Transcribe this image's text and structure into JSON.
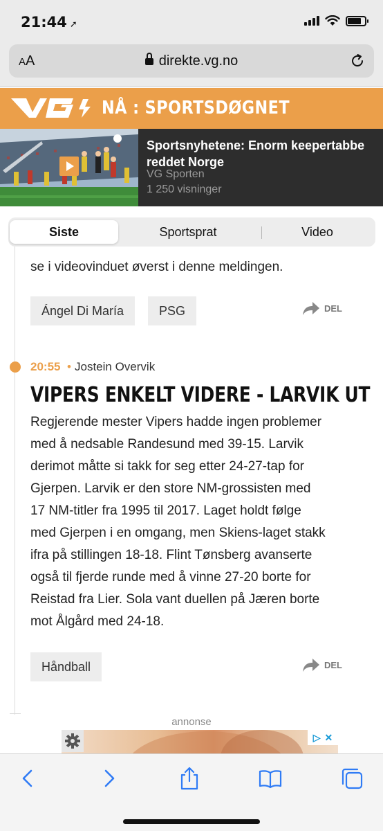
{
  "status_bar": {
    "time": "21:44",
    "location_arrow": "location-arrow-icon",
    "signal_icon": "cellular-signal-icon",
    "wifi_icon": "wifi-icon",
    "battery_icon": "battery-icon"
  },
  "browser": {
    "text_size_label_small": "A",
    "text_size_label_large": "A",
    "url": "direkte.vg.no",
    "lock_icon": "lock-icon",
    "reload_icon": "reload-icon"
  },
  "header": {
    "logo": "VG",
    "title": "NÅ : SPORTSDØGNET",
    "brand_color": "#eb9f4a"
  },
  "video_promo": {
    "title": "Sportsnyhetene: Enorm keepertabbe reddet Norge",
    "source": "VG Sporten",
    "views": "1 250 visninger",
    "play_icon": "play-icon"
  },
  "tabs": [
    {
      "label": "Siste",
      "active": true
    },
    {
      "label": "Sportsprat",
      "active": false
    },
    {
      "label": "Video",
      "active": false
    }
  ],
  "feed": {
    "prev_post": {
      "text_tail": "se i videovinduet øverst i denne meldingen.",
      "tags": [
        "Ángel Di María",
        "PSG"
      ],
      "share_label": "DEL"
    },
    "post": {
      "time": "20:55",
      "separator": "•",
      "author": "Jostein Overvik",
      "headline": "VIPERS ENKELT VIDERE - LARVIK UT",
      "body_lines": [
        "Regjerende mester Vipers hadde ingen problemer",
        "med å nedsable Randesund med 39-15. Larvik",
        "derimot måtte si takk for seg etter 24-27-tap for",
        "Gjerpen. Larvik er den store NM-grossisten med",
        "17 NM-titler fra 1995 til 2017. Laget holdt følge",
        "med Gjerpen i en omgang, men Skiens-laget stakk",
        "ifra på stillingen 18-18. Flint Tønsberg avanserte",
        "også til fjerde runde med å vinne 27-20 borte for",
        "Reistad fra Lier. Sola vant duellen på Jæren borte",
        "mot Ålgård med 24-18."
      ],
      "tags": [
        "Håndball"
      ],
      "share_label": "DEL"
    }
  },
  "ad": {
    "label": "annonse",
    "settings_icon": "gear-icon",
    "adchoices_icon": "adchoices-icon",
    "close_icon": "close-icon"
  },
  "toolbar": {
    "back_icon": "back-icon",
    "forward_icon": "forward-icon",
    "share_icon": "share-icon",
    "bookmarks_icon": "book-icon",
    "tabs_icon": "tabs-icon",
    "accent": "#2f7bf5"
  }
}
